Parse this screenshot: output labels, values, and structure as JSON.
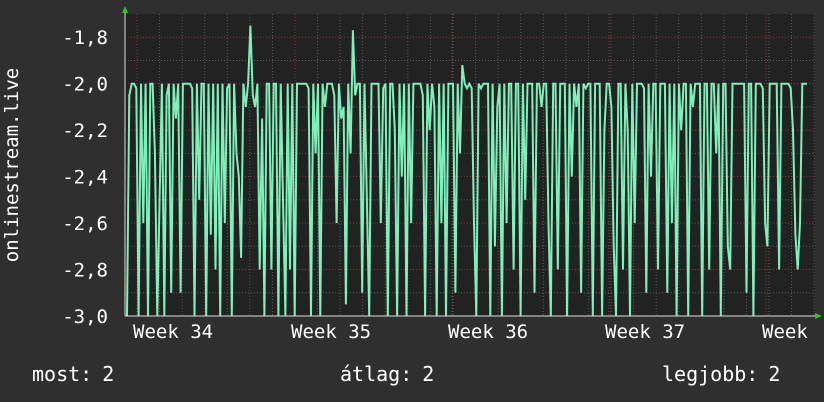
{
  "colors": {
    "background": "#2f2f2f",
    "plot_background": "#222222",
    "grid": "#5b5b5b",
    "grid_major": "#8a3a3a",
    "series": "#7ef0b9",
    "arrow": "#22cc22",
    "text": "#ffffff"
  },
  "chart_data": {
    "type": "line",
    "title": "",
    "ylabel": "onlinestream.live",
    "xlabel": "",
    "ylim": [
      -3.0,
      -1.7
    ],
    "yticks": [
      "-1,8",
      "-2,0",
      "-2,2",
      "-2,4",
      "-2,6",
      "-2,8",
      "-3,0"
    ],
    "ytick_values": [
      -1.8,
      -2.0,
      -2.2,
      -2.4,
      -2.6,
      -2.8,
      -3.0
    ],
    "xticks": [
      "Week 34",
      "Week 35",
      "Week 36",
      "Week 37",
      "Week"
    ],
    "grid": true,
    "series": [
      {
        "values": [
          -3.0,
          -2.05,
          -2.0,
          -2.0,
          -2.02,
          -3.0,
          -2.0,
          -2.6,
          -2.0,
          -3.0,
          -2.0,
          -2.0,
          -2.3,
          -3.0,
          -2.5,
          -2.0,
          -3.0,
          -2.05,
          -2.0,
          -2.9,
          -2.0,
          -2.15,
          -2.0,
          -2.9,
          -2.0,
          -2.0,
          -2.0,
          -2.0,
          -2.02,
          -3.0,
          -2.0,
          -2.5,
          -2.0,
          -2.0,
          -3.0,
          -2.0,
          -2.65,
          -2.0,
          -2.8,
          -2.0,
          -3.0,
          -2.0,
          -2.6,
          -2.02,
          -2.0,
          -3.0,
          -2.0,
          -2.3,
          -2.4,
          -2.75,
          -2.0,
          -2.1,
          -2.0,
          -1.75,
          -2.05,
          -2.1,
          -2.0,
          -2.8,
          -2.15,
          -3.0,
          -2.0,
          -2.0,
          -2.8,
          -2.0,
          -2.0,
          -3.0,
          -2.0,
          -2.5,
          -3.0,
          -2.0,
          -2.8,
          -2.0,
          -3.0,
          -2.0,
          -2.0,
          -2.0,
          -2.0,
          -2.0,
          -2.02,
          -3.0,
          -2.0,
          -2.3,
          -2.0,
          -3.0,
          -2.0,
          -2.1,
          -2.0,
          -2.0,
          -2.0,
          -2.05,
          -2.6,
          -2.0,
          -2.15,
          -2.1,
          -2.95,
          -2.0,
          -2.3,
          -1.77,
          -2.05,
          -2.0,
          -2.0,
          -2.9,
          -2.0,
          -2.5,
          -3.0,
          -2.0,
          -2.0,
          -2.0,
          -2.0,
          -2.6,
          -2.02,
          -2.0,
          -3.0,
          -2.0,
          -2.0,
          -2.2,
          -3.0,
          -2.0,
          -2.4,
          -2.0,
          -3.0,
          -2.0,
          -2.6,
          -2.0,
          -2.0,
          -2.0,
          -2.0,
          -2.05,
          -3.0,
          -2.0,
          -2.2,
          -2.0,
          -2.1,
          -3.0,
          -2.0,
          -2.6,
          -2.0,
          -3.0,
          -2.0,
          -2.0,
          -2.0,
          -2.9,
          -2.0,
          -2.3,
          -1.92,
          -2.0,
          -2.02,
          -2.0,
          -2.02,
          -2.6,
          -3.0,
          -2.0,
          -2.02,
          -2.0,
          -2.0,
          -2.0,
          -3.0,
          -2.0,
          -2.7,
          -2.1,
          -2.0,
          -3.0,
          -2.0,
          -2.6,
          -2.0,
          -2.0,
          -2.8,
          -2.0,
          -2.0,
          -3.0,
          -2.0,
          -2.5,
          -2.0,
          -2.0,
          -2.0,
          -2.9,
          -2.0,
          -2.0,
          -2.1,
          -2.0,
          -2.0,
          -2.6,
          -3.0,
          -2.0,
          -2.0,
          -2.8,
          -2.0,
          -2.0,
          -2.0,
          -3.0,
          -2.0,
          -2.4,
          -2.0,
          -2.1,
          -2.0,
          -2.9,
          -2.0,
          -2.02,
          -2.0,
          -2.0,
          -3.0,
          -2.0,
          -2.0,
          -2.0,
          -3.0,
          -2.2,
          -2.0,
          -2.0,
          -2.1,
          -2.7,
          -3.0,
          -2.0,
          -2.0,
          -2.8,
          -2.0,
          -2.2,
          -3.0,
          -2.0,
          -2.6,
          -2.0,
          -2.0,
          -2.0,
          -2.02,
          -2.9,
          -2.0,
          -2.4,
          -2.0,
          -2.0,
          -2.8,
          -2.0,
          -2.0,
          -2.0,
          -2.9,
          -2.0,
          -2.6,
          -2.0,
          -3.0,
          -2.0,
          -2.2,
          -2.0,
          -2.0,
          -3.0,
          -2.0,
          -2.1,
          -2.0,
          -2.0,
          -2.0,
          -3.0,
          -2.0,
          -2.0,
          -2.8,
          -2.0,
          -2.0,
          -2.3,
          -2.0,
          -3.0,
          -2.0,
          -2.0,
          -2.7,
          -2.8,
          -2.0,
          -2.0,
          -2.0,
          -2.0,
          -2.0,
          -2.0,
          -2.9,
          -2.0,
          -2.0,
          -3.0,
          -2.0,
          -2.0,
          -2.0,
          -2.02,
          -2.6,
          -2.7,
          -2.0,
          -2.0,
          -2.0,
          -2.0,
          -2.8,
          -2.0,
          -2.0,
          -2.0,
          -2.0,
          -2.02,
          -2.2,
          -2.65,
          -2.8,
          -2.6,
          -2.0,
          -2.0,
          -2.0
        ]
      }
    ]
  },
  "footer": {
    "current_label": "most:",
    "current_value": "2",
    "average_label": "átlag:",
    "average_value": "2",
    "max_label": "legjobb:",
    "max_value": "2"
  }
}
